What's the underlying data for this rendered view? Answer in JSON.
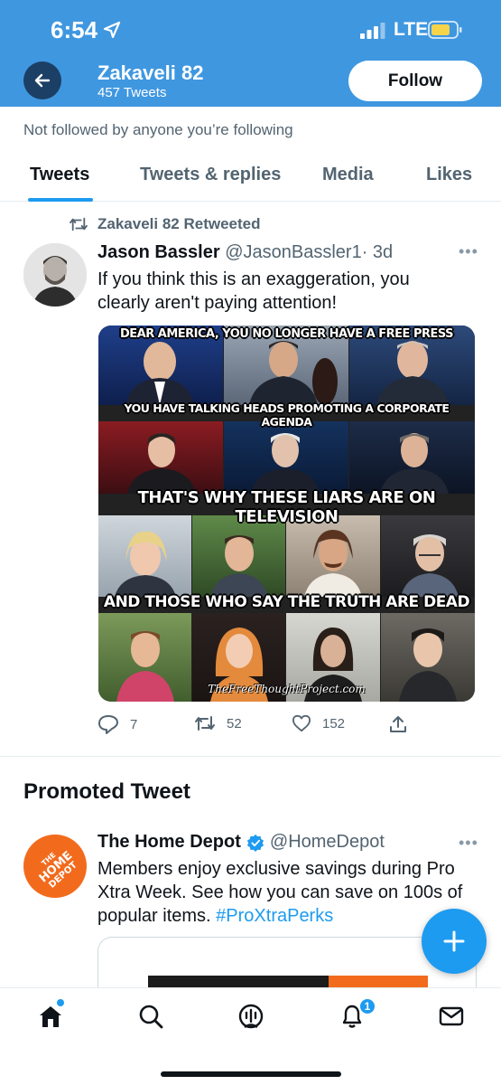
{
  "status_bar": {
    "time": "6:54",
    "network": "LTE"
  },
  "header": {
    "profile_name": "Zakaveli 82",
    "tweet_count": "457 Tweets",
    "follow_label": "Follow"
  },
  "not_followed": "Not followed by anyone you’re following",
  "tabs": [
    "Tweets",
    "Tweets & replies",
    "Media",
    "Likes"
  ],
  "active_tab": "Tweets",
  "tweet": {
    "retweeted_by": "Zakaveli 82 Retweeted",
    "author_name": "Jason Bassler",
    "author_handle": "@JasonBassler1",
    "separator": "·",
    "age": "3d",
    "text_line1": "If you think this is an exaggeration, you",
    "text_line2": "clearly aren't paying attention!",
    "image_captions": [
      "DEAR AMERICA, YOU NO LONGER HAVE A FREE PRESS",
      "YOU HAVE TALKING HEADS PROMOTING A CORPORATE AGENDA",
      "THAT'S WHY THESE LIARS ARE ON TELEVISION",
      "AND THOSE WHO SAY THE TRUTH ARE DEAD"
    ],
    "image_watermark": "TheFreeThoughtProject.com",
    "replies": "7",
    "retweets": "52",
    "likes": "152"
  },
  "promoted": {
    "heading": "Promoted Tweet",
    "logo_text_line1": "THE",
    "logo_text_line2": "HOME",
    "logo_text_line3": "DEPOT",
    "author_name": "The Home Depot",
    "author_handle": "@HomeDepot",
    "text_line1": "Members enjoy exclusive savings during Pro",
    "text_line2": "Xtra Week. See how you can save on 100s of",
    "text_line3_plain": "popular items. ",
    "hashtag": "#ProXtraPerks"
  },
  "bottom_nav": {
    "notification_count": "1"
  },
  "colors": {
    "header_blue": "#3f97e0",
    "twitter_blue": "#1d9bf0",
    "home_depot_orange": "#f26b1d",
    "secondary_text": "#536471"
  },
  "icons": [
    "location-arrow-icon",
    "signal-icon",
    "battery-icon",
    "back-arrow-icon",
    "retweet-icon",
    "more-icon",
    "reply-icon",
    "like-icon",
    "share-icon",
    "verified-icon",
    "compose-plus-icon",
    "home-icon",
    "search-icon",
    "spaces-icon",
    "notifications-icon",
    "messages-icon"
  ]
}
